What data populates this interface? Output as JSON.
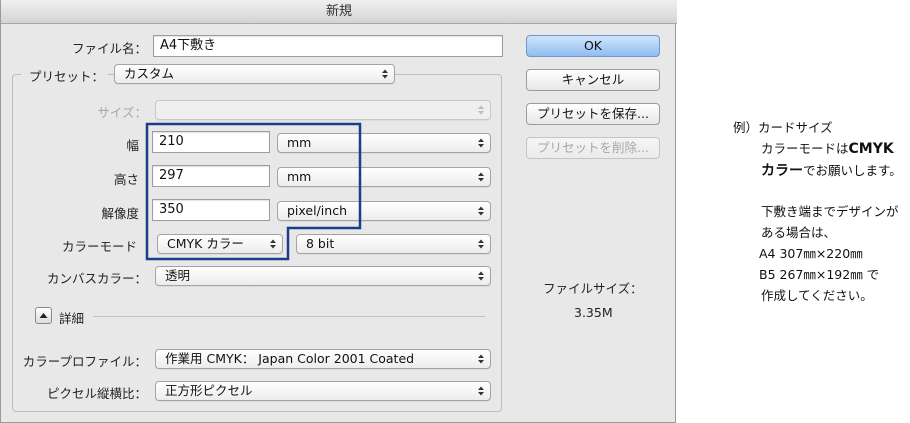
{
  "window": {
    "title": "新規"
  },
  "file_name": {
    "label": "ファイル名：",
    "value": "A4下敷き"
  },
  "preset": {
    "label": "プリセット：",
    "value": "カスタム"
  },
  "size": {
    "label": "サイズ：",
    "value": ""
  },
  "width": {
    "label": "幅",
    "value": "210",
    "unit": "mm"
  },
  "height": {
    "label": "高さ",
    "value": "297",
    "unit": "mm"
  },
  "resolution": {
    "label": "解像度",
    "value": "350",
    "unit": "pixel/inch"
  },
  "color_mode": {
    "label": "カラーモード",
    "value": "CMYK カラー",
    "bits": "8 bit"
  },
  "background": {
    "label": "カンバスカラー：",
    "value": "透明"
  },
  "advanced": {
    "label": "詳細"
  },
  "color_profile": {
    "label": "カラープロファイル：",
    "value": "作業用 CMYK： Japan Color 2001 Coated"
  },
  "pixel_aspect": {
    "label": "ピクセル縦横比：",
    "value": "正方形ピクセル"
  },
  "buttons": {
    "ok": "OK",
    "cancel": "キャンセル",
    "save_preset": "プリセットを保存...",
    "delete_preset": "プリセットを削除..."
  },
  "file_size": {
    "label": "ファイルサイズ：",
    "value": "3.35M"
  },
  "note": {
    "prefix": "例）",
    "line1": "カードサイズ",
    "line2_a": "カラーモードは",
    "line2_b": "CMYK",
    "line3_a": "カラー",
    "line3_b": "でお願いします。",
    "line4": "下敷き端までデザインが",
    "line5": "ある場合は、",
    "line6": "A4 307㎜×220㎜",
    "line7": "B5 267㎜×192㎜ で",
    "line8": "作成してください。"
  },
  "colors": {
    "highlight": "#1a3f8a",
    "default_button": "#8fbdf0"
  },
  "icons": {
    "select_arrows": "updown-arrows-icon",
    "disclosure": "disclosure-up-icon"
  }
}
